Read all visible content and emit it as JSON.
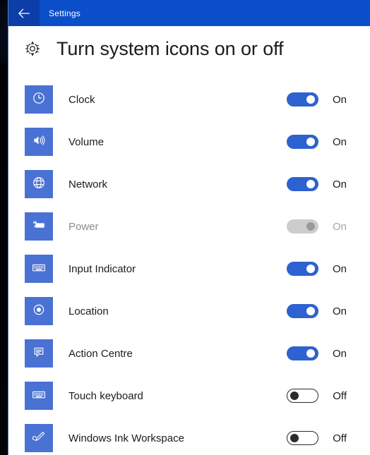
{
  "titlebar": {
    "back_icon": "back-arrow-icon",
    "app_name": "Settings"
  },
  "page": {
    "heading_icon": "gear-icon",
    "heading": "Turn system icons on or off"
  },
  "labels": {
    "on": "On",
    "off": "Off"
  },
  "rows": [
    {
      "icon": "clock-icon",
      "label": "Clock",
      "state": "On",
      "mode": "on"
    },
    {
      "icon": "volume-icon",
      "label": "Volume",
      "state": "On",
      "mode": "on"
    },
    {
      "icon": "network-globe-icon",
      "label": "Network",
      "state": "On",
      "mode": "on"
    },
    {
      "icon": "battery-power-icon",
      "label": "Power",
      "state": "On",
      "mode": "disabled"
    },
    {
      "icon": "keyboard-icon",
      "label": "Input Indicator",
      "state": "On",
      "mode": "on"
    },
    {
      "icon": "location-icon",
      "label": "Location",
      "state": "On",
      "mode": "on"
    },
    {
      "icon": "action-centre-icon",
      "label": "Action Centre",
      "state": "On",
      "mode": "on"
    },
    {
      "icon": "touch-keyboard-icon",
      "label": "Touch keyboard",
      "state": "Off",
      "mode": "off"
    },
    {
      "icon": "pen-ink-icon",
      "label": "Windows Ink Workspace",
      "state": "Off",
      "mode": "off"
    }
  ],
  "colors": {
    "titlebar_blue": "#0b4ec9",
    "back_button_blue": "#0b3ea6",
    "tile_blue": "#4a72d4",
    "toggle_blue": "#2d62d0",
    "toggle_disabled_grey": "#cdcdcd",
    "text_primary": "#1b1b1b"
  }
}
